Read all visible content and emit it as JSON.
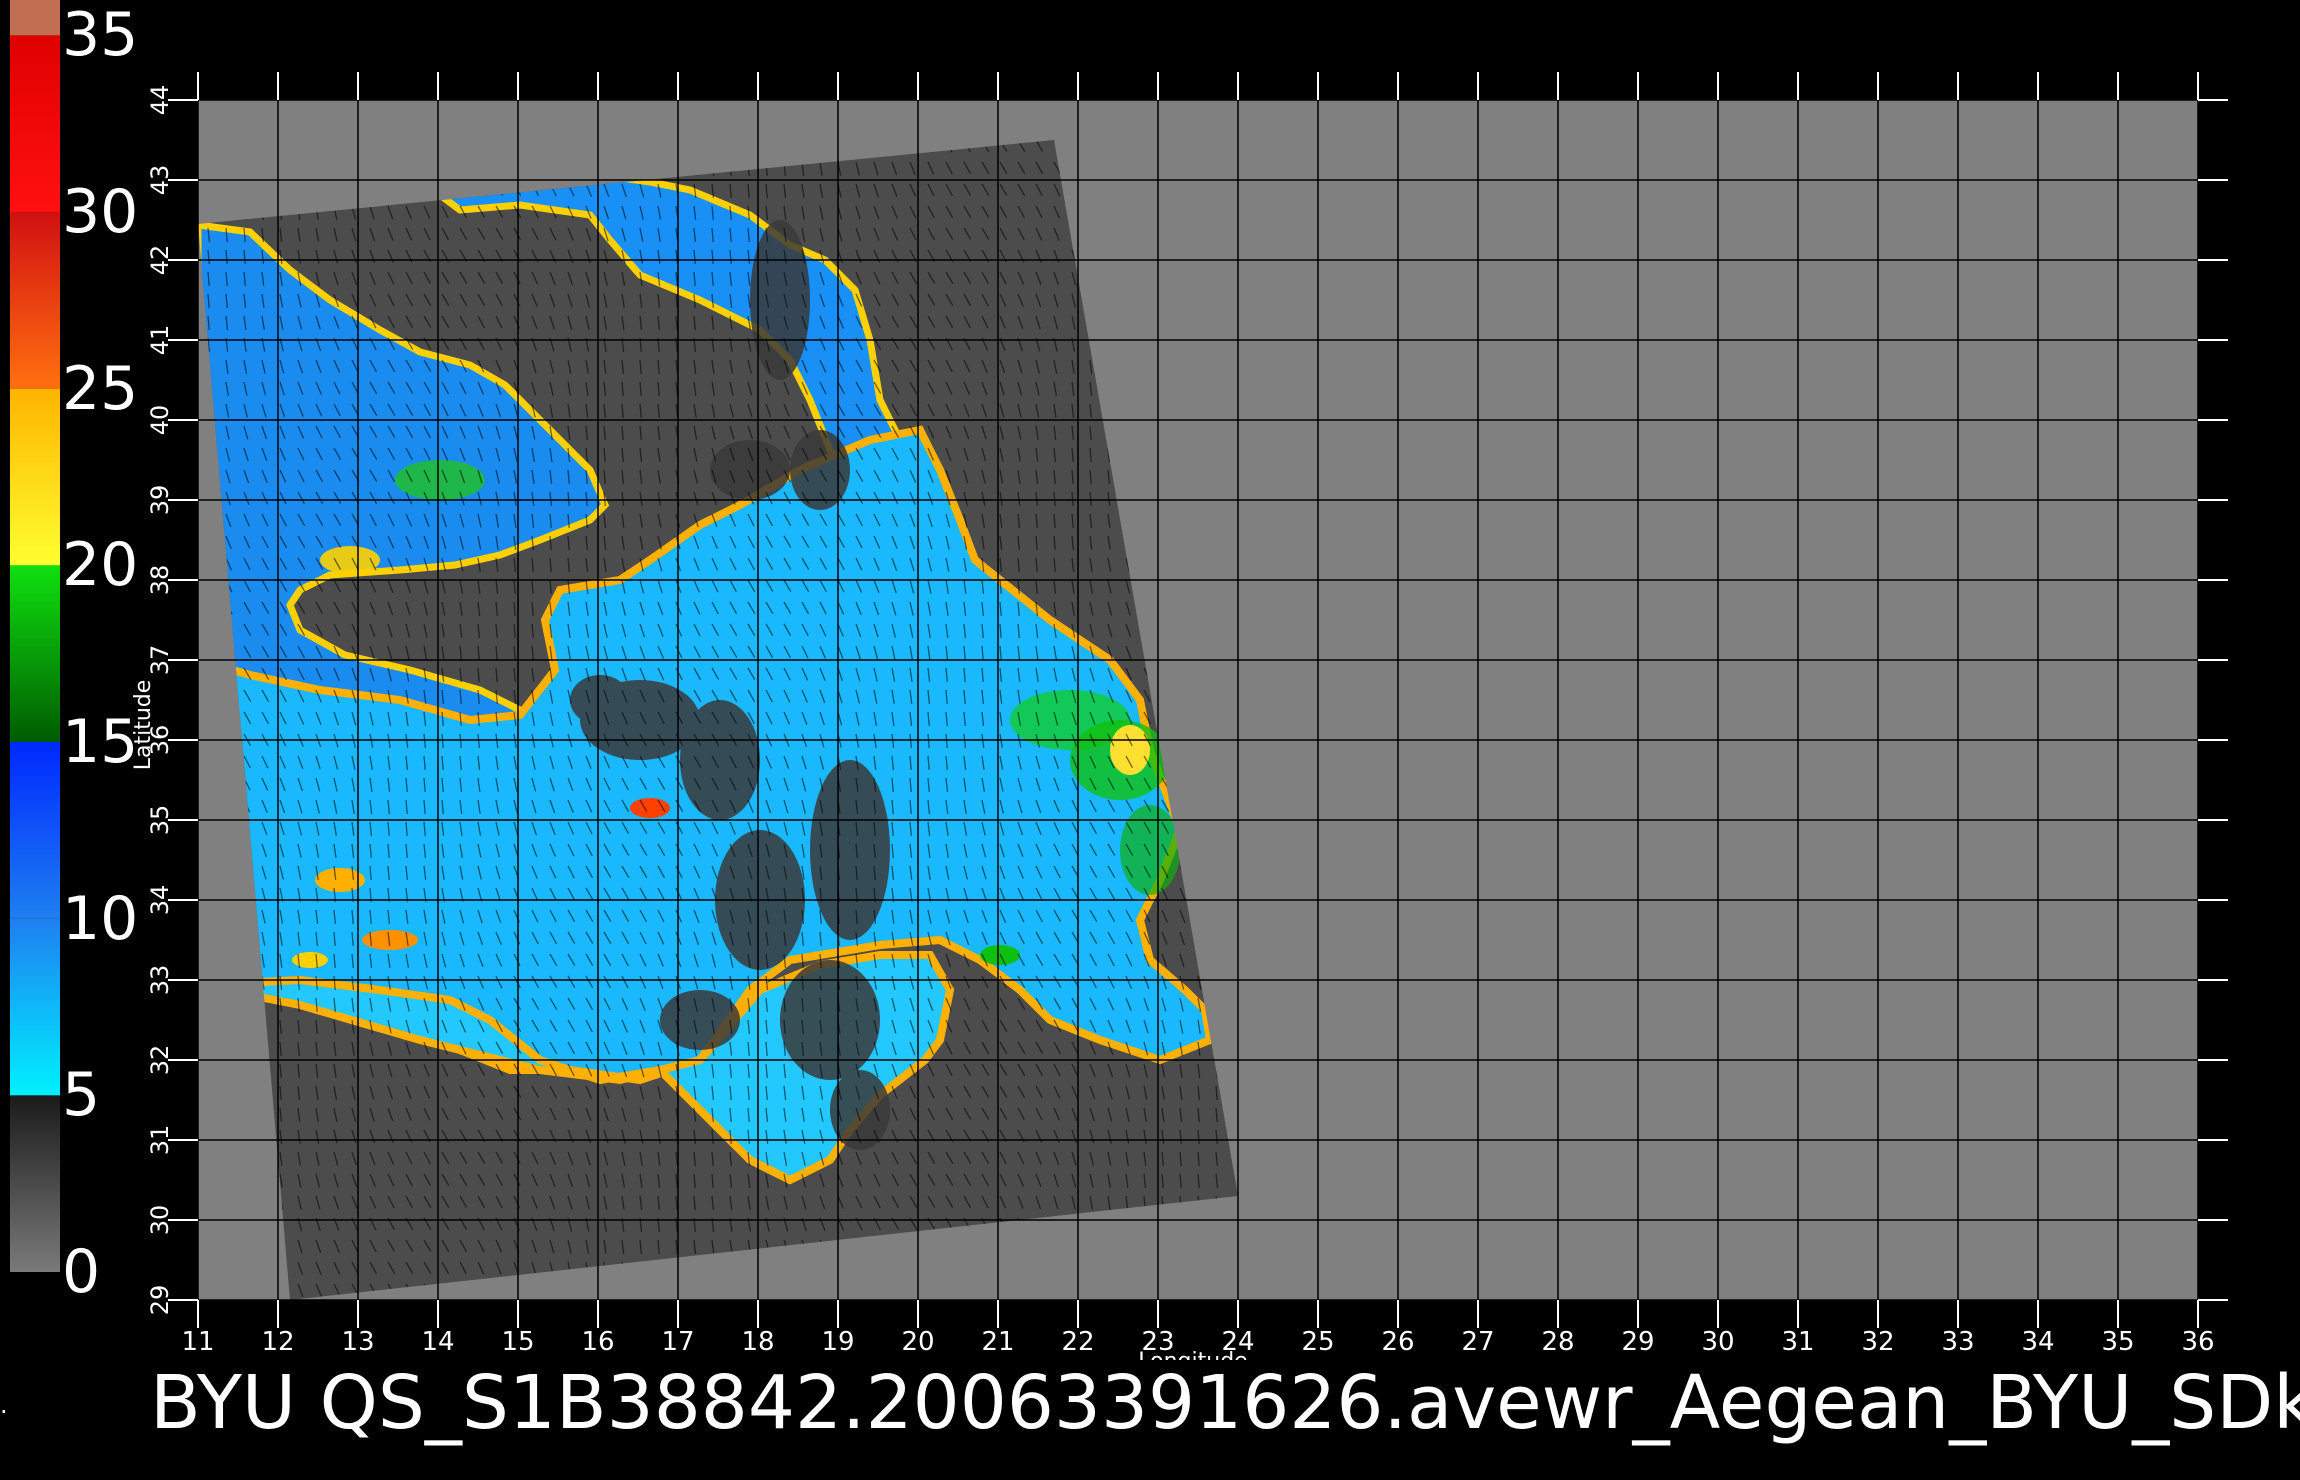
{
  "title": "BYU  QS_S1B38842.20063391626.avewr_Aegean_BYU_SDk",
  "colorbar": {
    "tick_labels": [
      "35",
      "30",
      "25",
      "20",
      "15",
      "10",
      "5",
      "0"
    ],
    "segments": [
      {
        "from": 0,
        "to": 5,
        "color_start": "#7a7a7a",
        "color_end": "#1a1a1a"
      },
      {
        "from": 5,
        "to": 10,
        "color_start": "#00f0ff",
        "color_end": "#1e7ff0"
      },
      {
        "from": 10,
        "to": 15,
        "color_start": "#1e7ff0",
        "color_end": "#0028ff"
      },
      {
        "from": 15,
        "to": 20,
        "color_start": "#005c00",
        "color_end": "#10e010"
      },
      {
        "from": 20,
        "to": 25,
        "color_start": "#ffff30",
        "color_end": "#ffb400"
      },
      {
        "from": 25,
        "to": 30,
        "color_start": "#ff7010",
        "color_end": "#d01010"
      },
      {
        "from": 30,
        "to": 35,
        "color_start": "#ff1010",
        "color_end": "#e00000"
      },
      {
        "from": 35,
        "to": 36,
        "color_start": "#c07050",
        "color_end": "#c07050"
      }
    ]
  },
  "map": {
    "xlabel": "Longitude",
    "ylabel": "Latitude",
    "lon_range": [
      11,
      36
    ],
    "lat_range": [
      29,
      44
    ],
    "lon_ticks": [
      "11",
      "12",
      "13",
      "14",
      "15",
      "16",
      "17",
      "18",
      "19",
      "20",
      "21",
      "22",
      "23",
      "24",
      "25",
      "26",
      "27",
      "28",
      "29",
      "30",
      "31",
      "32",
      "33",
      "34",
      "35",
      "36"
    ],
    "lat_ticks": [
      "29",
      "30",
      "31",
      "32",
      "33",
      "34",
      "35",
      "36",
      "37",
      "38",
      "39",
      "40",
      "41",
      "42",
      "43",
      "44"
    ],
    "background_color": "#808080",
    "swath_color": "#4c4c4c",
    "grid_color": "#000000",
    "swath_corners_lonlat": [
      [
        11.0,
        42.45
      ],
      [
        21.7,
        43.5
      ],
      [
        24.0,
        30.3
      ],
      [
        12.15,
        29.0
      ]
    ]
  }
}
